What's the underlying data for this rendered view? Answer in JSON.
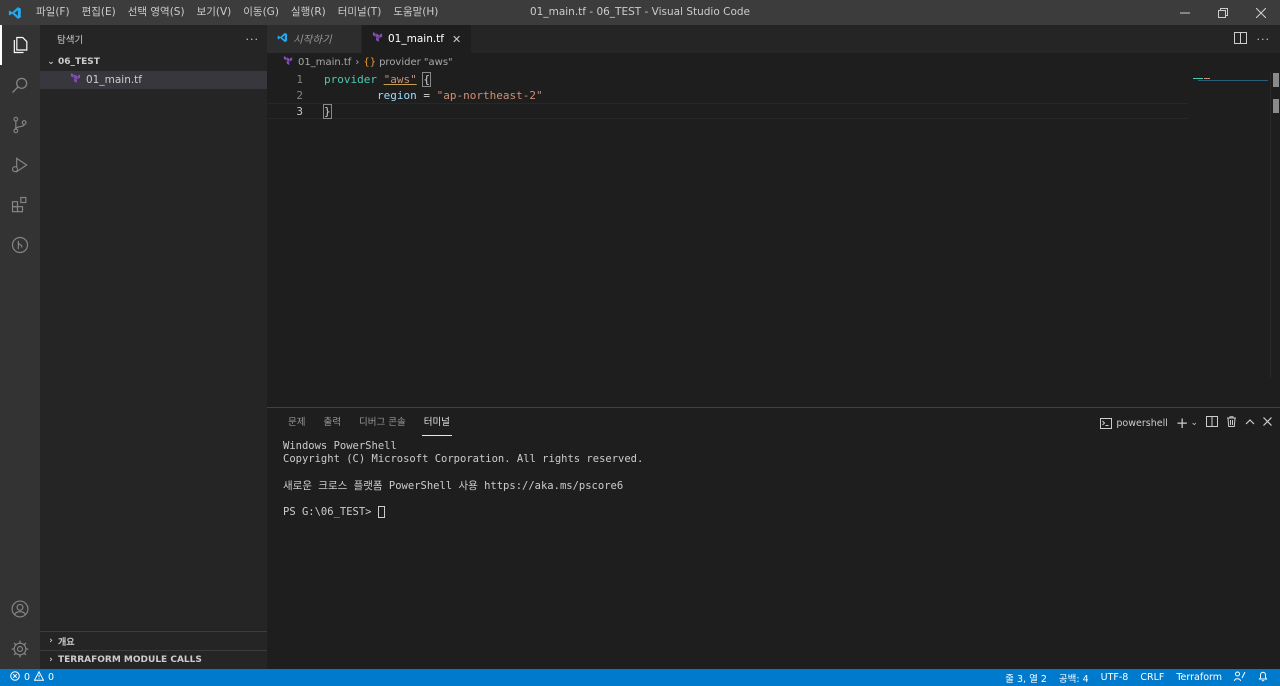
{
  "window": {
    "title": "01_main.tf - 06_TEST - Visual Studio Code"
  },
  "menu": [
    "파일(F)",
    "편집(E)",
    "선택 영역(S)",
    "보기(V)",
    "이동(G)",
    "실행(R)",
    "터미널(T)",
    "도움말(H)"
  ],
  "sidebar": {
    "title": "탐색기",
    "more": "···",
    "folder": "06_TEST",
    "files": [
      {
        "name": "01_main.tf"
      }
    ],
    "bottom_sections": [
      "개요",
      "TERRAFORM MODULE CALLS"
    ]
  },
  "tabs": [
    {
      "label": "시작하기",
      "active": false
    },
    {
      "label": "01_main.tf",
      "active": true
    }
  ],
  "breadcrumb": {
    "file": "01_main.tf",
    "symbol": "provider \"aws\""
  },
  "code": {
    "line_numbers": [
      "1",
      "2",
      "3"
    ],
    "line1": {
      "kw": "provider",
      "str": "\"aws\"",
      "brace": "{"
    },
    "line2": {
      "attr": "region",
      "op": " = ",
      "str": "\"ap-northeast-2\""
    },
    "line3": {
      "brace": "}"
    }
  },
  "panel": {
    "tabs": [
      "문제",
      "출력",
      "디버그 콘솔",
      "터미널"
    ],
    "active_tab": "터미널",
    "shell": "powershell",
    "terminal_lines": [
      "Windows PowerShell",
      "Copyright (C) Microsoft Corporation. All rights reserved.",
      "",
      "새로운 크로스 플랫폼 PowerShell 사용 https://aka.ms/pscore6",
      ""
    ],
    "prompt": "PS G:\\06_TEST> "
  },
  "status": {
    "errors": "0",
    "warnings": "0",
    "position": "줄 3, 열 2",
    "spaces": "공백: 4",
    "encoding": "UTF-8",
    "eol": "CRLF",
    "language": "Terraform"
  },
  "colors": {
    "accent": "#007acc",
    "terraform": "#844fba"
  }
}
